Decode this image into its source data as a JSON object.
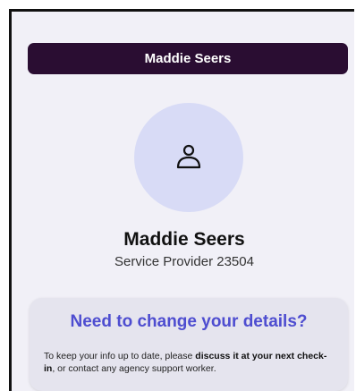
{
  "header": {
    "title": "Maddie Seers"
  },
  "profile": {
    "avatar_icon": "user-icon",
    "name": "Maddie Seers",
    "role": "Service Provider 23504"
  },
  "info_card": {
    "title": "Need to change your details?",
    "text_part1": "To keep your info up to date, please ",
    "text_bold": "discuss it at your next check-in",
    "text_part2": ", or contact any agency support worker."
  },
  "colors": {
    "header_bg": "#2a0d32",
    "accent": "#4e4dd0",
    "avatar_bg": "#d8dbf6",
    "page_bg": "#f1f0f7"
  }
}
